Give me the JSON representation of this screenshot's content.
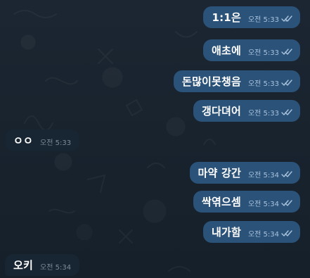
{
  "colors": {
    "background": "#18222d",
    "outgoing_bubble": "#2b5278",
    "incoming_bubble": "#182533",
    "outgoing_time": "#a9c3dd",
    "incoming_time": "#7d8c99"
  },
  "messages": [
    {
      "text": "1:1은",
      "time": "오전 5:33",
      "direction": "outgoing",
      "status": "read-double-check-icon"
    },
    {
      "text": "애초에",
      "time": "오전 5:33",
      "direction": "outgoing",
      "status": "read-double-check-icon"
    },
    {
      "text": "돈많이못챙음",
      "time": "오전 5:33",
      "direction": "outgoing",
      "status": "read-double-check-icon"
    },
    {
      "text": "갱다뎌어",
      "time": "오전 5:33",
      "direction": "outgoing",
      "status": "read-double-check-icon"
    },
    {
      "text": "ㅇㅇ",
      "time": "오전 5:33",
      "direction": "incoming"
    },
    {
      "text": "마약 강간",
      "time": "오전 5:34",
      "direction": "outgoing",
      "status": "read-double-check-icon"
    },
    {
      "text": "싹엮으셈",
      "time": "오전 5:34",
      "direction": "outgoing",
      "status": "read-double-check-icon"
    },
    {
      "text": "내가함",
      "time": "오전 5:34",
      "direction": "outgoing",
      "status": "read-double-check-icon"
    },
    {
      "text": "오키",
      "time": "오전 5:34",
      "direction": "incoming"
    }
  ]
}
